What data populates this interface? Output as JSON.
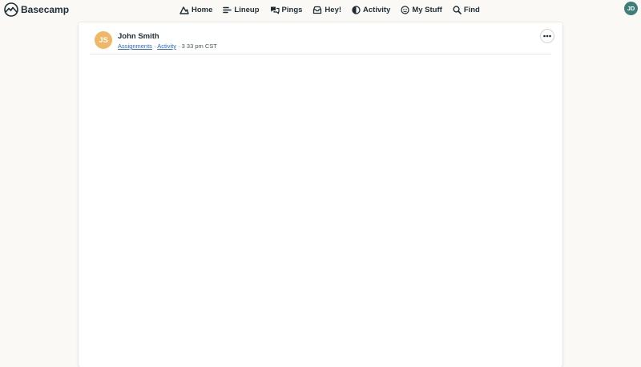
{
  "app": {
    "name": "Basecamp"
  },
  "nav": {
    "items": [
      {
        "label": "Home",
        "icon": "home-icon"
      },
      {
        "label": "Lineup",
        "icon": "lineup-icon"
      },
      {
        "label": "Pings",
        "icon": "pings-icon"
      },
      {
        "label": "Hey!",
        "icon": "hey-icon"
      },
      {
        "label": "Activity",
        "icon": "activity-icon"
      },
      {
        "label": "My Stuff",
        "icon": "my-stuff-icon"
      },
      {
        "label": "Find",
        "icon": "search-icon"
      }
    ]
  },
  "user": {
    "initials": "JD",
    "color": "#3d7d7a"
  },
  "post": {
    "author": "John Smith",
    "author_initials": "JS",
    "author_color": "#f1b767",
    "breadcrumb": [
      "Assignments",
      "Activity"
    ],
    "time": "3 33 pm CST",
    "separator": "·"
  },
  "colors": {
    "background": "#fbf9f5",
    "link": "#2e66c2"
  }
}
